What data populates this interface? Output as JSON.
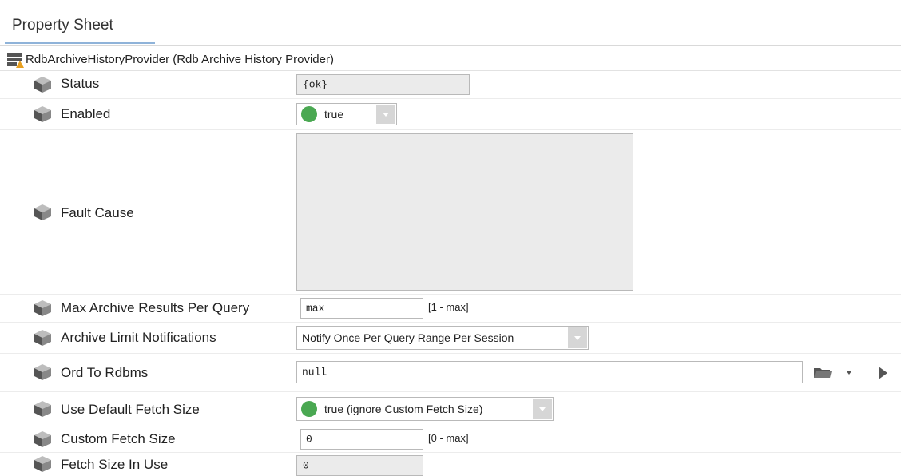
{
  "tab": {
    "label": "Property Sheet"
  },
  "component": {
    "title": "RdbArchiveHistoryProvider  (Rdb Archive History Provider)"
  },
  "properties": {
    "status": {
      "label": "Status",
      "value": "{ok}"
    },
    "enabled": {
      "label": "Enabled",
      "value": "true"
    },
    "fault_cause": {
      "label": "Fault Cause",
      "value": ""
    },
    "max_results": {
      "label": "Max Archive Results Per Query",
      "value": "max",
      "range": "[1 - max]"
    },
    "limit_notifications": {
      "label": "Archive Limit Notifications",
      "value": "Notify Once Per Query Range Per Session"
    },
    "ord_to_rdbms": {
      "label": "Ord To Rdbms",
      "value": "null"
    },
    "use_default_fetch": {
      "label": "Use Default Fetch Size",
      "value": "true (ignore Custom Fetch Size)"
    },
    "custom_fetch": {
      "label": "Custom Fetch Size",
      "value": "0",
      "range": "[0 - max]"
    },
    "fetch_in_use": {
      "label": "Fetch Size In Use",
      "value": "0"
    }
  },
  "colors": {
    "enabled_dot": "#4aa852",
    "tab_underline": "#8fb3d9"
  },
  "icons": [
    "database-icon",
    "cube-icon",
    "folder-icon",
    "chevron-down-icon",
    "play-icon"
  ]
}
